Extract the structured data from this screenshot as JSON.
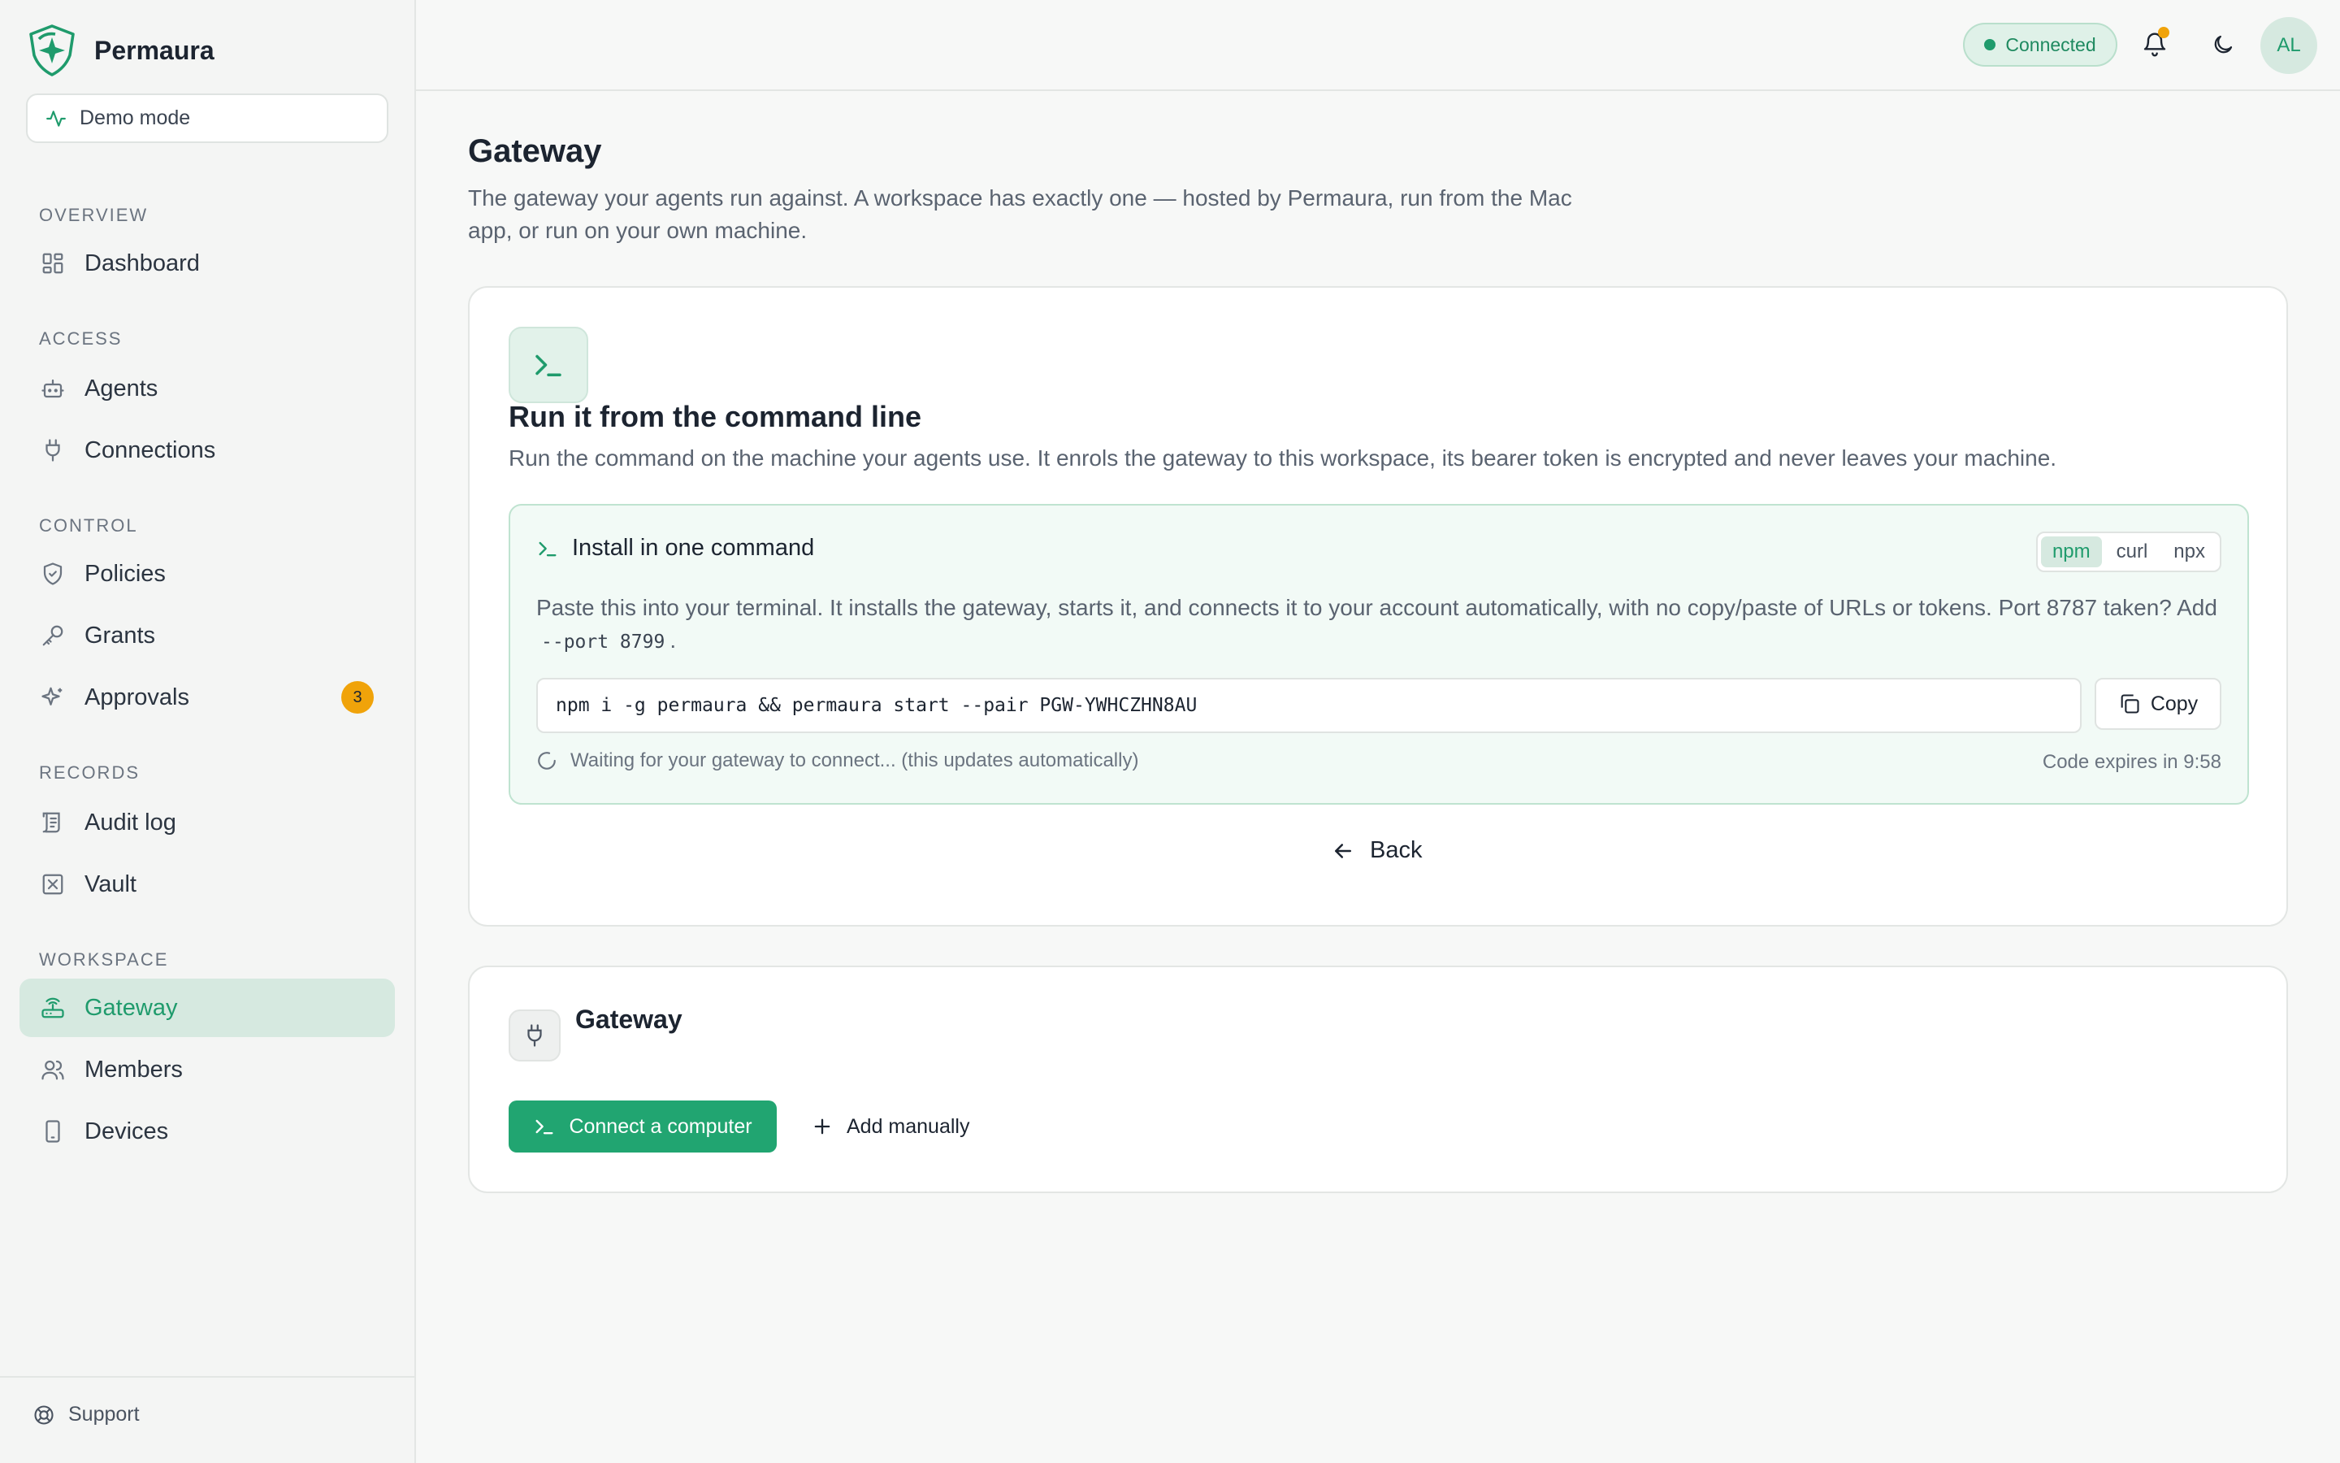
{
  "brand": {
    "name": "Permaura",
    "demo_label": "Demo mode"
  },
  "nav": {
    "sections": {
      "overview": "OVERVIEW",
      "access": "ACCESS",
      "control": "CONTROL",
      "records": "RECORDS",
      "workspace": "WORKSPACE"
    },
    "items": {
      "dashboard": "Dashboard",
      "agents": "Agents",
      "connections": "Connections",
      "policies": "Policies",
      "grants": "Grants",
      "approvals": "Approvals",
      "approvals_count": "3",
      "audit_log": "Audit log",
      "vault": "Vault",
      "gateway": "Gateway",
      "members": "Members",
      "devices": "Devices"
    },
    "support": "Support"
  },
  "topbar": {
    "status": "Connected",
    "avatar": "AL"
  },
  "page": {
    "title": "Gateway",
    "description": "The gateway your agents run against. A workspace has exactly one — hosted by Permaura, run from the Mac app, or run on your own machine."
  },
  "cli_card": {
    "title": "Run it from the command line",
    "subtitle": "Run the command on the machine your agents use. It enrols the gateway to this workspace, its bearer token is encrypted and never leaves your machine.",
    "install": {
      "title": "Install in one command",
      "tabs": {
        "npm": "npm",
        "curl": "curl",
        "npx": "npx"
      },
      "desc_part1": "Paste this into your terminal. It installs the gateway, starts it, and connects it to your account automatically, with no copy/paste of URLs or tokens. Port 8787 taken? Add",
      "desc_code": "--port 8799",
      "desc_part2": ".",
      "command": "npm i -g permaura && permaura start --pair PGW-YWHCZHN8AU",
      "copy_label": "Copy",
      "waiting": "Waiting for your gateway to connect... (this updates automatically)",
      "expires": "Code expires in 9:58"
    },
    "back_label": "Back"
  },
  "gateway_card": {
    "title": "Gateway",
    "connect_label": "Connect a computer",
    "add_label": "Add manually"
  },
  "colors": {
    "accent": "#1f9b6c",
    "accent_bg": "#d6e9e0",
    "badge": "#f0a30a"
  }
}
